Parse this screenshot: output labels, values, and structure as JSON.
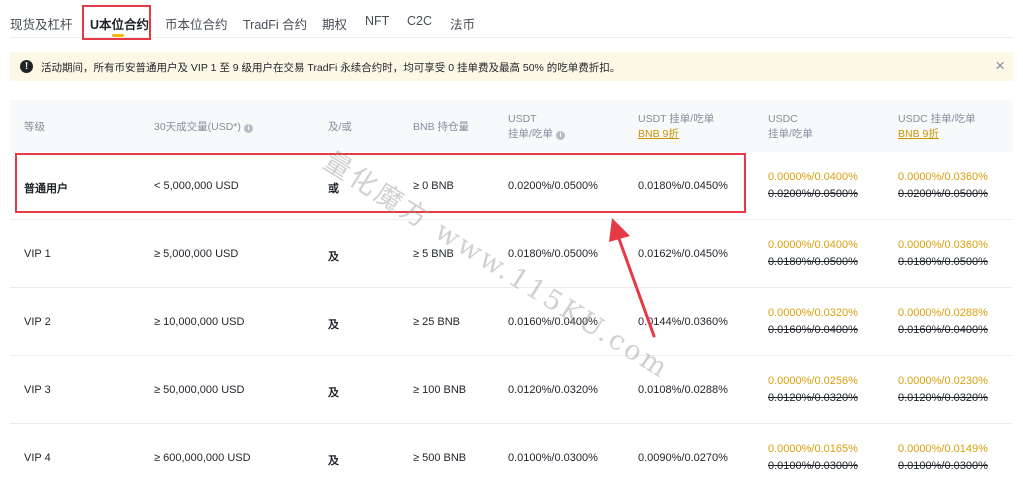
{
  "tabs": [
    {
      "label": "现货及杠杆"
    },
    {
      "label": "U本位合约",
      "active": true
    },
    {
      "label": "币本位合约"
    },
    {
      "label": "TradFi 合约"
    },
    {
      "label": "期权"
    },
    {
      "label": "NFT"
    },
    {
      "label": "C2C"
    },
    {
      "label": "法币"
    }
  ],
  "notice": {
    "icon": "exclamation-icon",
    "text": "活动期间，所有币安普通用户及 VIP 1 至 9 级用户在交易 TradFi 永续合约时，均可享受 0 挂单费及最高 50% 的吃单费折扣。",
    "close": "×"
  },
  "table": {
    "headers": {
      "level": "等级",
      "volume": "30天成交量(USD*)",
      "andor": "及/或",
      "bnb": "BNB 持仓量",
      "usdt_line1": "USDT",
      "usdt_line2": "挂单/吃单",
      "usdt_disc_line1": "USDT 挂单/吃单",
      "usdt_disc_line2": "BNB 9折",
      "usdc_line1": "USDC",
      "usdc_line2": "挂单/吃单",
      "usdc_disc_line1": "USDC 挂单/吃单",
      "usdc_disc_line2": "BNB 9折"
    },
    "rows": [
      {
        "level": "普通用户",
        "volume": "< 5,000,000 USD",
        "andor": "或",
        "bnb": "≥ 0 BNB",
        "usdt": "0.0200%/0.0500%",
        "usdt_disc": "0.0180%/0.0450%",
        "usdc_new": "0.0000%/0.0400%",
        "usdc_old": "0.0200%/0.0500%",
        "usdc_disc_new": "0.0000%/0.0360%",
        "usdc_disc_old": "0.0200%/0.0500%"
      },
      {
        "level": "VIP 1",
        "volume": "≥ 5,000,000 USD",
        "andor": "及",
        "bnb": "≥ 5 BNB",
        "usdt": "0.0180%/0.0500%",
        "usdt_disc": "0.0162%/0.0450%",
        "usdc_new": "0.0000%/0.0400%",
        "usdc_old": "0.0180%/0.0500%",
        "usdc_disc_new": "0.0000%/0.0360%",
        "usdc_disc_old": "0.0180%/0.0500%"
      },
      {
        "level": "VIP 2",
        "volume": "≥ 10,000,000 USD",
        "andor": "及",
        "bnb": "≥ 25 BNB",
        "usdt": "0.0160%/0.0400%",
        "usdt_disc": "0.0144%/0.0360%",
        "usdc_new": "0.0000%/0.0320%",
        "usdc_old": "0.0160%/0.0400%",
        "usdc_disc_new": "0.0000%/0.0288%",
        "usdc_disc_old": "0.0160%/0.0400%"
      },
      {
        "level": "VIP 3",
        "volume": "≥ 50,000,000 USD",
        "andor": "及",
        "bnb": "≥ 100 BNB",
        "usdt": "0.0120%/0.0320%",
        "usdt_disc": "0.0108%/0.0288%",
        "usdc_new": "0.0000%/0.0256%",
        "usdc_old": "0.0120%/0.0320%",
        "usdc_disc_new": "0.0000%/0.0230%",
        "usdc_disc_old": "0.0120%/0.0320%"
      },
      {
        "level": "VIP 4",
        "volume": "≥ 600,000,000 USD",
        "andor": "及",
        "bnb": "≥ 500 BNB",
        "usdt": "0.0100%/0.0300%",
        "usdt_disc": "0.0090%/0.0270%",
        "usdc_new": "0.0000%/0.0165%",
        "usdc_old": "0.0100%/0.0300%",
        "usdc_disc_new": "0.0000%/0.0149%",
        "usdc_disc_old": "0.0100%/0.0300%"
      }
    ]
  },
  "watermark": "量化魔方 www.115KU.com",
  "colors": {
    "brand_yellow": "#f0b90b",
    "discount_text": "#d89f0c",
    "annotation_red": "#e63946",
    "notice_bg": "#fdf8e5"
  }
}
